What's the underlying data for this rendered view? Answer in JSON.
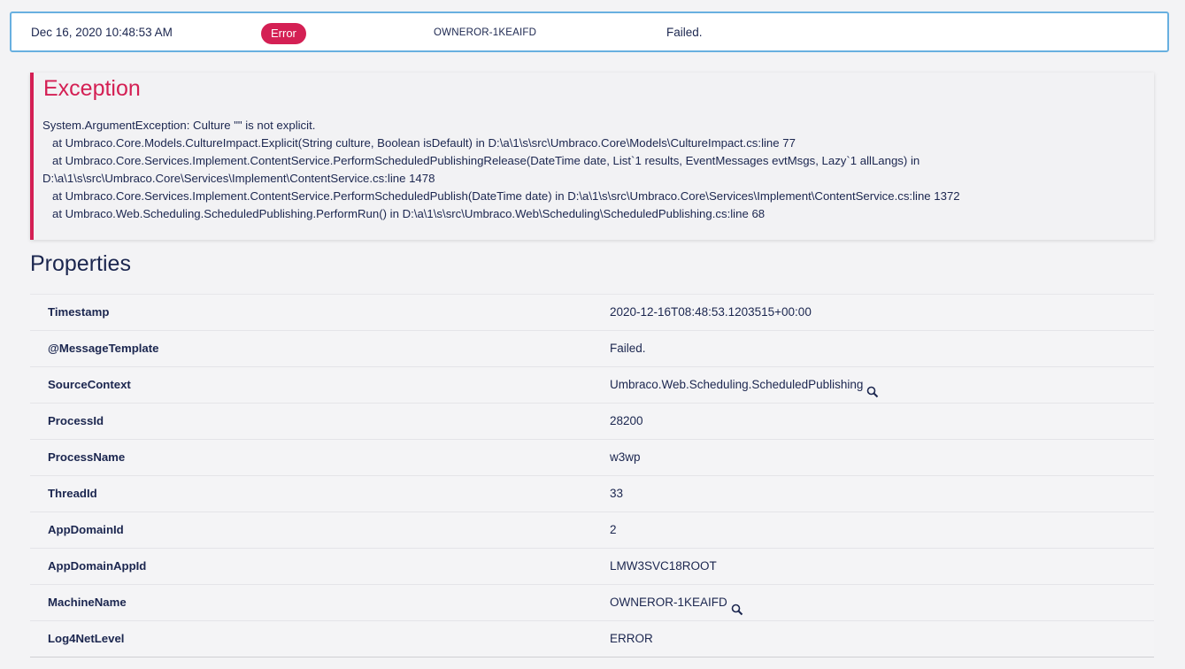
{
  "log_entry": {
    "timestamp": "Dec 16, 2020 10:48:53 AM",
    "level": "Error",
    "machine": "OWNEROR-1KEAIFD",
    "message": "Failed.",
    "colors": {
      "error": "#d42054",
      "border": "#68b0e0"
    }
  },
  "exception": {
    "title": "Exception",
    "text": "System.ArgumentException: Culture \"\" is not explicit.\n   at Umbraco.Core.Models.CultureImpact.Explicit(String culture, Boolean isDefault) in D:\\a\\1\\s\\src\\Umbraco.Core\\Models\\CultureImpact.cs:line 77\n   at Umbraco.Core.Services.Implement.ContentService.PerformScheduledPublishingRelease(DateTime date, List`1 results, EventMessages evtMsgs, Lazy`1 allLangs) in\nD:\\a\\1\\s\\src\\Umbraco.Core\\Services\\Implement\\ContentService.cs:line 1478\n   at Umbraco.Core.Services.Implement.ContentService.PerformScheduledPublish(DateTime date) in D:\\a\\1\\s\\src\\Umbraco.Core\\Services\\Implement\\ContentService.cs:line 1372\n   at Umbraco.Web.Scheduling.ScheduledPublishing.PerformRun() in D:\\a\\1\\s\\src\\Umbraco.Web\\Scheduling\\ScheduledPublishing.cs:line 68"
  },
  "properties": {
    "title": "Properties",
    "rows": [
      {
        "name": "Timestamp",
        "value": "2020-12-16T08:48:53.1203515+00:00"
      },
      {
        "name": "@MessageTemplate",
        "value": "Failed."
      },
      {
        "name": "SourceContext",
        "value": "Umbraco.Web.Scheduling.ScheduledPublishing",
        "icon": "search-icon"
      },
      {
        "name": "ProcessId",
        "value": "28200"
      },
      {
        "name": "ProcessName",
        "value": "w3wp"
      },
      {
        "name": "ThreadId",
        "value": "33"
      },
      {
        "name": "AppDomainId",
        "value": "2"
      },
      {
        "name": "AppDomainAppId",
        "value": "LMW3SVC18ROOT"
      },
      {
        "name": "MachineName",
        "value": "OWNEROR-1KEAIFD",
        "icon": "search-icon"
      },
      {
        "name": "Log4NetLevel",
        "value": "ERROR"
      }
    ]
  }
}
